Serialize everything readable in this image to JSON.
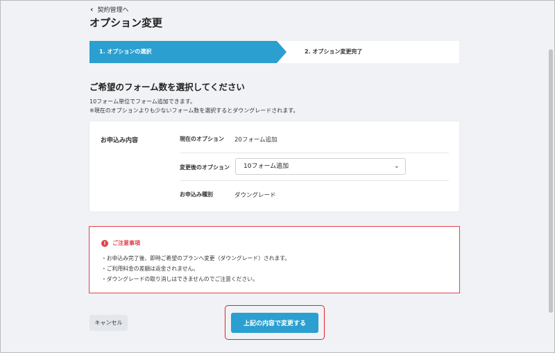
{
  "nav": {
    "back_label": "契約管理へ"
  },
  "page": {
    "title": "オプション変更"
  },
  "stepper": {
    "steps": [
      {
        "label": "1. オプションの選択",
        "active": true
      },
      {
        "label": "2. オプション変更完了",
        "active": false
      }
    ]
  },
  "section": {
    "title": "ご希望のフォーム数を選択してください",
    "description_lines": [
      "10フォーム単位でフォーム追加できます。",
      "※現在のオプションよりも少ないフォーム数を選択するとダウングレードされます。"
    ]
  },
  "application": {
    "label": "お申込み内容",
    "rows": [
      {
        "key": "現在のオプション",
        "value": "20フォーム追加"
      },
      {
        "key": "変更後のオプション",
        "value": "10フォーム追加"
      },
      {
        "key": "お申込み種別",
        "value": "ダウングレード"
      }
    ]
  },
  "notice": {
    "title": "ご注意事項",
    "items": [
      "・お申込み完了後、即時ご希望のプランへ変更（ダウングレード）されます。",
      "・ご利用料金の差額は返金されません。",
      "・ダウングレードの取り消しはできませんのでご注意ください。"
    ]
  },
  "actions": {
    "cancel_label": "キャンセル",
    "submit_label": "上記の内容で変更する"
  },
  "icons": {
    "back": "chevron-left-icon",
    "dropdown": "chevron-down-icon",
    "warning": "alert-circle-icon"
  },
  "colors": {
    "accent": "#2b9fd0",
    "alert": "#e0414b",
    "highlight": "#e0202a",
    "background": "#f0f2f5"
  }
}
